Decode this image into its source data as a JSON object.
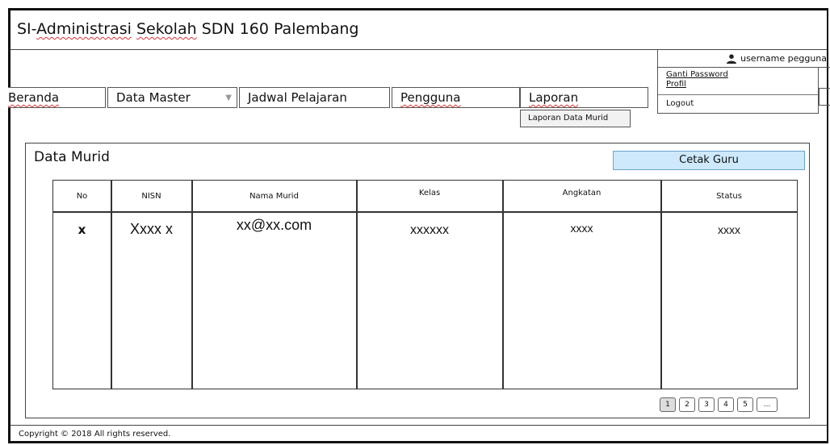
{
  "app": {
    "title_prefix": "SI-",
    "title_underlined": "Administrasi",
    "title_mid": " ",
    "title_underlined2": "Sekolah",
    "title_suffix": " SDN 160 Palembang"
  },
  "user": {
    "name": "username pegguna",
    "menu": {
      "change_password": "Ganti Password",
      "profile": "Profil",
      "logout": "Logout"
    }
  },
  "nav": {
    "items": [
      {
        "label": "Beranda"
      },
      {
        "label": "Data Master"
      },
      {
        "label": "Jadwal Pelajaran"
      },
      {
        "label": "Pengguna"
      },
      {
        "label": "Laporan"
      }
    ],
    "laporan_sub": "Laporan Data Murid"
  },
  "panel": {
    "title": "Data Murid",
    "print_button": "Cetak Guru",
    "table": {
      "headers": [
        "No",
        "NISN",
        "Nama Murid",
        "Kelas",
        "Angkatan",
        "Status"
      ],
      "rows": [
        [
          "x",
          "Xxxx x",
          "xx@xx.com",
          "xxxxxx",
          "xxxx",
          "xxxx"
        ]
      ]
    },
    "pagination": [
      "1",
      "2",
      "3",
      "4",
      "5",
      "..."
    ]
  },
  "footer": {
    "copyright": "Copyright © 2018  All rights reserved."
  },
  "colors": {
    "button_bg": "#cde9fb",
    "button_border": "#6aa6cf",
    "spell_underline": "#d33"
  }
}
